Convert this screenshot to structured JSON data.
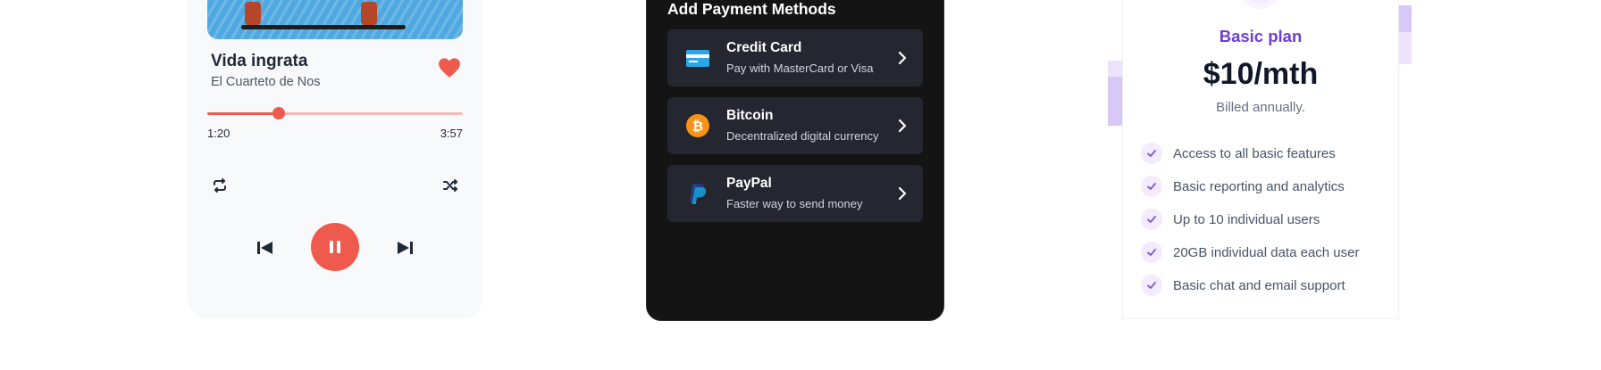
{
  "player": {
    "song_title": "Vida ingrata",
    "artist": "El Cuarteto de Nos",
    "elapsed": "1:20",
    "total": "3:57",
    "progress_fraction": 0.28,
    "liked": true,
    "accent_color": "#ef5a4f"
  },
  "payment": {
    "title": "Add Payment Methods",
    "methods": [
      {
        "label": "Credit Card",
        "subtitle": "Pay with MasterCard or Visa",
        "icon": "credit-card-icon"
      },
      {
        "label": "Bitcoin",
        "subtitle": "Decentralized digital currency",
        "icon": "bitcoin-icon"
      },
      {
        "label": "PayPal",
        "subtitle": "Faster way to send money",
        "icon": "paypal-icon"
      }
    ]
  },
  "pricing": {
    "plan_name": "Basic plan",
    "price": "$10/mth",
    "billing": "Billed annually.",
    "features": [
      "Access to all basic features",
      "Basic reporting and analytics",
      "Up to 10 individual users",
      "20GB individual data each user",
      "Basic chat and email support"
    ],
    "accent_color": "#7f56d9"
  }
}
